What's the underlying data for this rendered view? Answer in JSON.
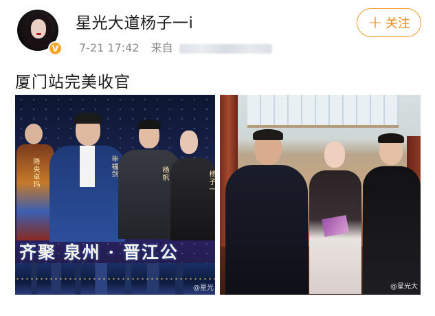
{
  "post": {
    "username": "星光大道杨子一i",
    "time": "7-21 17:42",
    "source_prefix": "来自",
    "follow_label": "关注",
    "follow_icon": "plus-icon",
    "verified_badge": "V",
    "text": "厦门站完美收官"
  },
  "photos": [
    {
      "banner": "齐聚 泉州 · 晋江公",
      "labels": [
        "降央卓玛",
        "毕福剑",
        "杨帆",
        "杨子一"
      ],
      "watermark": "@星光"
    },
    {
      "watermark": "@星光大"
    }
  ],
  "colors": {
    "follow_accent": "#f08a18",
    "verified_badge": "#f6a623",
    "meta_text": "#8a8a8a"
  }
}
